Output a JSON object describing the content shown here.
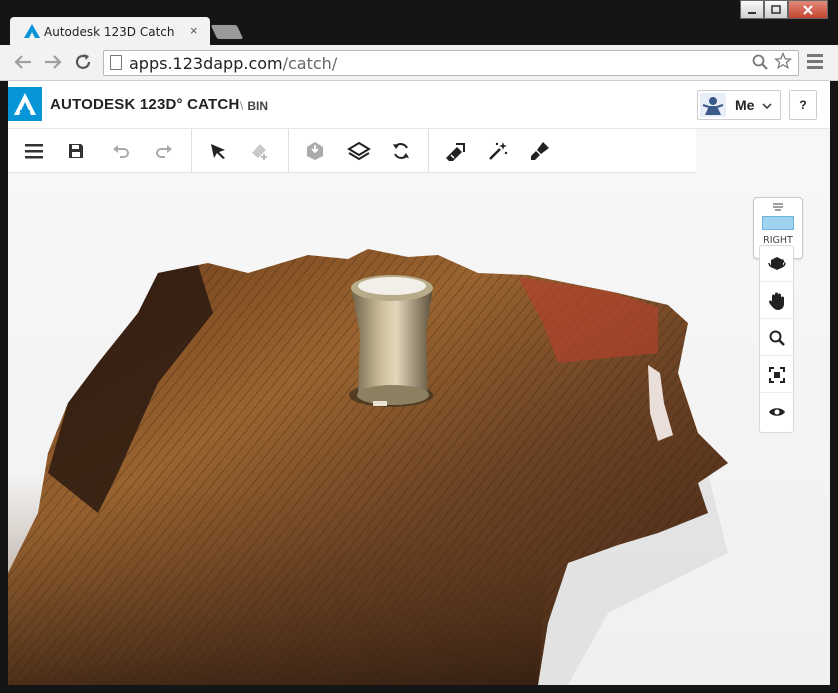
{
  "browser": {
    "tab_title": "Autodesk 123D Catch",
    "close_glyph": "×",
    "url_host": "apps.123dapp.com",
    "url_path": "/catch/",
    "window_controls": [
      "minimize",
      "maximize",
      "close"
    ]
  },
  "app": {
    "brand": "AUTODESK 123D° CATCH",
    "breadcrumb_sep": "\\",
    "breadcrumb": "BIN",
    "user_label": "Me",
    "help_label": "?",
    "accent_color": "#0696d7"
  },
  "toolbar": {
    "groups": [
      [
        "menu-icon",
        "save-icon",
        "undo-icon",
        "redo-icon"
      ],
      [
        "select-icon",
        "erase-icon"
      ],
      [
        "fill-icon",
        "layers-icon",
        "refresh-icon"
      ],
      [
        "measure-icon",
        "magic-wand-icon",
        "brush-icon"
      ]
    ]
  },
  "viewcube": {
    "face_label": "RIGHT"
  },
  "nav_tools": [
    "orbit-icon",
    "pan-icon",
    "zoom-icon",
    "fit-icon",
    "view-icon"
  ]
}
